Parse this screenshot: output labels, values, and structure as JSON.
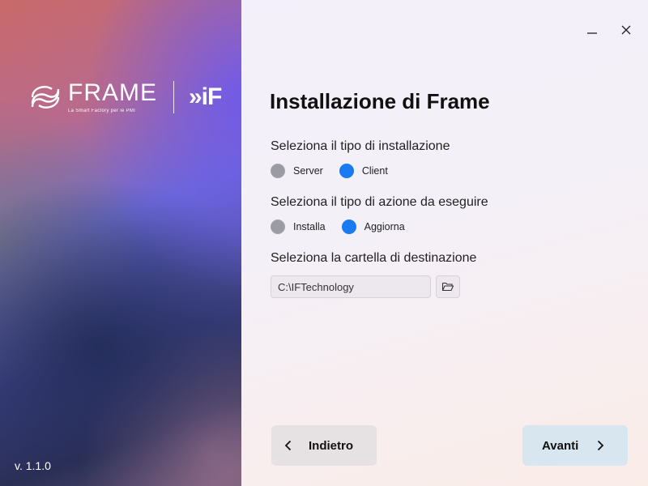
{
  "branding": {
    "product": "FRAME",
    "tagline": "La Smart Factory per le PMI",
    "partner": "»iF",
    "version": "v. 1.1.0"
  },
  "window_controls": {
    "minimize_icon": "minimize-icon",
    "close_icon": "close-icon"
  },
  "main": {
    "title": "Installazione di Frame",
    "install_type": {
      "label": "Seleziona il tipo di installazione",
      "options": [
        {
          "label": "Server",
          "selected": false
        },
        {
          "label": "Client",
          "selected": true
        }
      ]
    },
    "action_type": {
      "label": "Seleziona il tipo di azione da eseguire",
      "options": [
        {
          "label": "Installa",
          "selected": false
        },
        {
          "label": "Aggiorna",
          "selected": true
        }
      ]
    },
    "destination": {
      "label": "Seleziona la cartella di destinazione",
      "value": "C:\\IFTechnology",
      "browse_icon": "folder-open-icon"
    }
  },
  "footer": {
    "back_label": "Indietro",
    "next_label": "Avanti"
  },
  "colors": {
    "accent": "#1a7af2",
    "radio_off": "#9b9ba3",
    "next_button": "#d8e6f0",
    "back_button": "#e6e1e3"
  }
}
